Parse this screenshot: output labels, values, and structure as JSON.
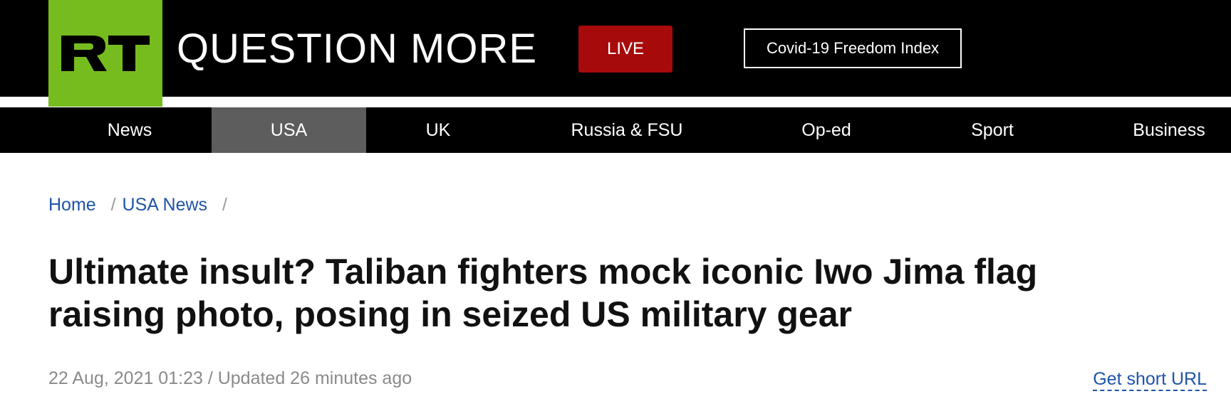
{
  "brand": {
    "logo_text": "RT",
    "tagline": "QUESTION MORE",
    "logo_bg": "#77bc1f"
  },
  "header": {
    "live_label": "LIVE",
    "live_color": "#a70a0a",
    "covid_label": "Covid-19 Freedom Index"
  },
  "nav": {
    "items": [
      {
        "label": "News"
      },
      {
        "label": "USA",
        "active": true
      },
      {
        "label": "UK"
      },
      {
        "label": "Russia & FSU"
      },
      {
        "label": "Op-ed"
      },
      {
        "label": "Sport"
      },
      {
        "label": "Business"
      }
    ]
  },
  "breadcrumb": {
    "home": "Home",
    "section": "USA News",
    "separator": "/"
  },
  "article": {
    "headline": "Ultimate insult? Taliban fighters mock iconic Iwo Jima flag raising photo, posing in seized US military gear",
    "date": "22 Aug, 2021 01:23",
    "updated": "/ Updated 26 minutes ago",
    "short_url_label": "Get short URL"
  },
  "colors": {
    "link": "#1e54a8",
    "nav_active": "#5d5d5d"
  }
}
